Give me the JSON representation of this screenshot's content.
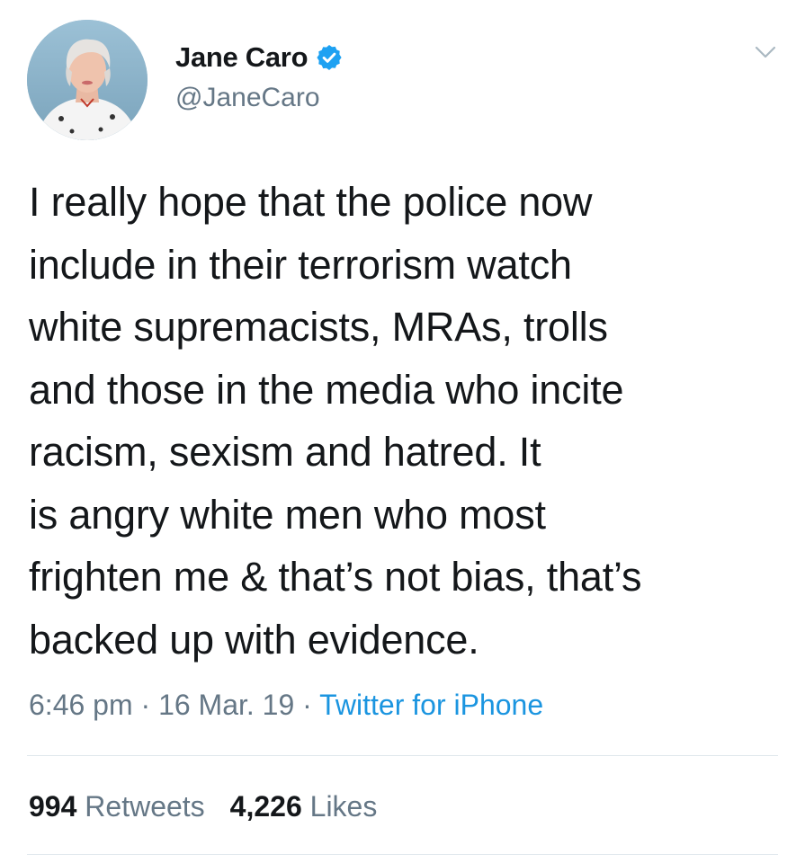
{
  "author": {
    "display_name": "Jane Caro",
    "handle": "@JaneCaro",
    "verified": true,
    "verified_color": "#1da1f2"
  },
  "tweet": {
    "text": "I really hope that the police now\ninclude in their terrorism watch\nwhite supremacists, MRAs, trolls\nand those in the media who incite\nracism, sexism and hatred. It\nis angry white men who most\nfrighten me & that’s not bias, that’s\nbacked up with evidence."
  },
  "meta": {
    "time": "6:46 pm",
    "sep1": " · ",
    "date": "16 Mar. 19",
    "sep2": " · ",
    "source": "Twitter for iPhone",
    "source_color": "#1b95e0"
  },
  "stats": {
    "retweets_count": "994",
    "retweets_label": "Retweets",
    "likes_count": "4,226",
    "likes_label": "Likes"
  },
  "icons": {
    "verified": "verified-badge-icon",
    "menu": "chevron-down-icon",
    "avatar": "profile-photo"
  },
  "colors": {
    "text": "#14171a",
    "secondary": "#657786",
    "divider": "#e1e8ed"
  }
}
